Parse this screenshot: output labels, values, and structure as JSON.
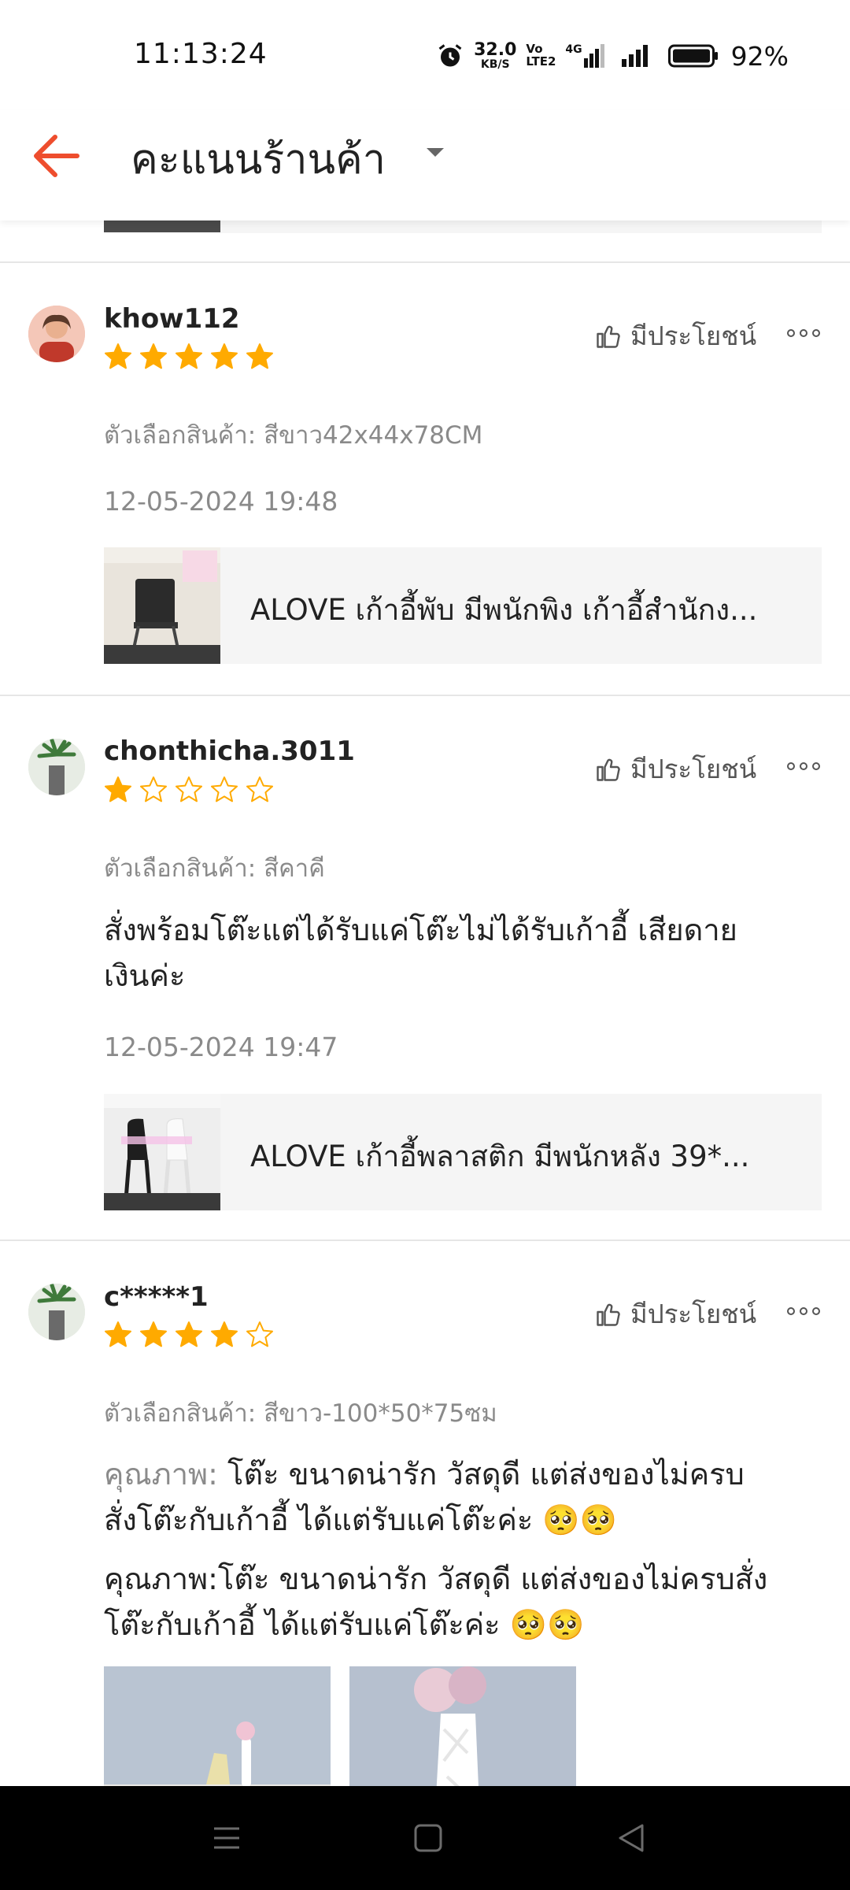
{
  "status_bar": {
    "time": "11:13:24",
    "net_speed_value": "32.0",
    "net_speed_unit": "KB/S",
    "volte_top": "Vo",
    "volte_bottom": "LTE2",
    "network": "4G",
    "battery": "92%"
  },
  "header": {
    "title": "คะแนนร้านค้า"
  },
  "reviews": [
    {
      "username": "khow112",
      "rating": 5,
      "helpful_label": "มีประโยชน์",
      "variation": "ตัวเลือกสินค้า: สีขาว42x44x78CM",
      "date": "12-05-2024 19:48",
      "product_title": "ALOVE เก้าอี้พับ มีพนักพิง เก้าอี้สำนักง..."
    },
    {
      "username": "chonthicha.3011",
      "rating": 1,
      "helpful_label": "มีประโยชน์",
      "variation": "ตัวเลือกสินค้า: สีคาคี",
      "comment_line1": "สั่งพร้อมโต๊ะแต่ได้รับแค่โต๊ะไม่ได้รับเก้าอี้  เสียดาย",
      "comment_line2": "เงินค่ะ",
      "date": "12-05-2024 19:47",
      "product_title": "ALOVE เก้าอี้พลาสติก มีพนักหลัง 39*..."
    },
    {
      "username": "c*****1",
      "rating": 4,
      "helpful_label": "มีประโยชน์",
      "variation": "ตัวเลือกสินค้า: สีขาว-100*50*75ซม",
      "quality_label": "คุณภาพ:",
      "quality_text_line1": " โต๊ะ ขนาดน่ารัก วัสดุดี    แต่ส่งของไม่ครบ",
      "quality_text_line2": "สั่งโต๊ะกับเก้าอี้ ได้แต่รับแค่โต๊ะค่ะ    🥺🥺",
      "comment_line1": "คุณภาพ:โต๊ะ ขนาดน่ารัก วัสดุดี    แต่ส่งของไม่ครบสั่ง",
      "comment_line2": "โต๊ะกับเก้าอี้ ได้แต่รับแค่โต๊ะค่ะ    🥺🥺"
    }
  ],
  "colors": {
    "accent": "#EE4D2D",
    "star": "#FFAA00",
    "secondary_text": "#8A8A8A"
  },
  "icons": [
    "back-arrow-icon",
    "caret-down-icon",
    "thumbs-up-icon",
    "more-icon",
    "alarm-icon",
    "battery-icon",
    "signal-icon"
  ]
}
